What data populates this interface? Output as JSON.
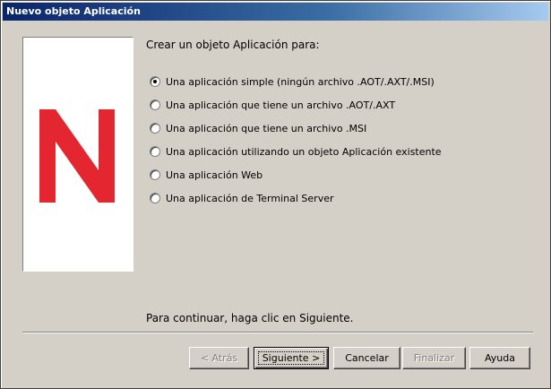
{
  "window": {
    "title": "Nuevo objeto Aplicación"
  },
  "brand": {
    "logo_icon": "novell-n-logo",
    "logo_color": "#e3262f"
  },
  "main": {
    "intro": "Crear un objeto Aplicación para:",
    "options": [
      {
        "label": "Una aplicación simple (ningún archivo .AOT/.AXT/.MSI)",
        "checked": true
      },
      {
        "label": "Una aplicación que tiene un archivo .AOT/.AXT",
        "checked": false
      },
      {
        "label": "Una aplicación que tiene un archivo .MSI",
        "checked": false
      },
      {
        "label": "Una aplicación utilizando un objeto Aplicación existente",
        "checked": false
      },
      {
        "label": "Una aplicación Web",
        "checked": false
      },
      {
        "label": "Una aplicación de Terminal Server",
        "checked": false
      }
    ],
    "hint": "Para continuar, haga clic en Siguiente."
  },
  "buttons": {
    "back": "< Atrás",
    "next": "Siguiente >",
    "cancel": "Cancelar",
    "finish": "Finalizar",
    "help": "Ayuda"
  }
}
